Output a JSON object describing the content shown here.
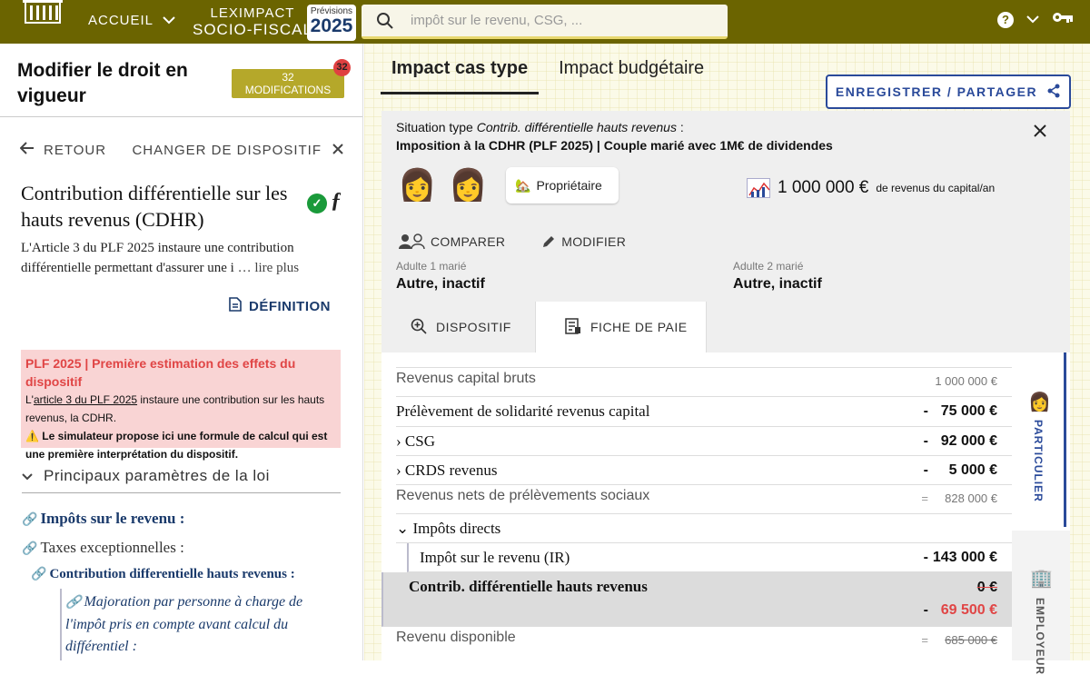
{
  "header": {
    "logo_text": "ASSEMBLÉE NATIONALE",
    "accueil": "ACCUEIL",
    "brand_line1": "LEXIMPACT",
    "brand_line2": "SOCIO-FISCAL",
    "previsions_label": "Prévisions",
    "previsions_year": "2025",
    "search_placeholder": "impôt sur le revenu, CSG, ..."
  },
  "left": {
    "title": "Modifier le droit en vigueur",
    "mod_count": "32",
    "mod_label": "MODIFICATIONS",
    "badge": "32",
    "back": "RETOUR",
    "change": "CHANGER DE DISPOSITIF",
    "provision_title": "Contribution différentielle sur les hauts revenus (CDHR)",
    "provision_desc": "L'Article 3 du PLF 2025 instaure une contribution différentielle permettant d'assurer une i",
    "read_more": "… lire plus",
    "definition": "DÉFINITION",
    "alert_title": "PLF 2025 | Première estimation des effets du dispositif",
    "alert_pre": "L'",
    "alert_link": "article 3 du PLF 2025",
    "alert_post": " instaure une contribution sur les hauts revenus, la CDHR.",
    "alert_warning": "⚠️ Le simulateur propose ici une formule de calcul qui est une première interprétation du dispositif.",
    "params_heading": "Principaux paramètres de la loi",
    "links": [
      "Impôts sur le revenu :",
      "Taxes exceptionnelles :",
      "Contribution differentielle hauts revenus :",
      "Majoration par personne à charge de l'impôt pris en compte avant calcul du différentiel :"
    ]
  },
  "right": {
    "tabs": [
      "Impact cas type",
      "Impact budgétaire"
    ],
    "save": "ENREGISTRER / PARTAGER",
    "situation_prefix": "Situation type ",
    "situation_italic": "Contrib. différentielle hauts revenus",
    "situation_suffix": " :",
    "situation_line2": "Imposition à la CDHR (PLF 2025) | Couple marié avec 1M€ de dividendes",
    "owner": "Propriétaire",
    "revenue_amount": "1 000 000 €",
    "revenue_label": "de revenus du capital/an",
    "compare": "COMPARER",
    "modify": "MODIFIER",
    "adult1_label": "Adulte 1 marié",
    "adult1_value": "Autre, inactif",
    "adult2_label": "Adulte 2 marié",
    "adult2_value": "Autre, inactif",
    "subtabs": [
      "DISPOSITIF",
      "FICHE DE PAIE"
    ],
    "side_tabs": [
      "PARTICULIER",
      "EMPLOYEUR"
    ],
    "rows": [
      {
        "label": "Revenus capital bruts",
        "op": "",
        "value": "1 000 000 €"
      },
      {
        "label": "Prélèvement de solidarité revenus capital",
        "op": "-",
        "value": "75 000 €"
      },
      {
        "label": "› CSG",
        "op": "-",
        "value": "92 000 €"
      },
      {
        "label": "› CRDS revenus",
        "op": "-",
        "value": "5 000 €"
      },
      {
        "label": "Revenus nets de prélèvements sociaux",
        "op": "=",
        "value": "828 000 €"
      },
      {
        "label": "⌄ Impôts directs",
        "op": "",
        "value": ""
      },
      {
        "label": "Impôt sur le revenu (IR)",
        "op": "-",
        "value": "143 000 €"
      },
      {
        "label": "Contrib. différentielle hauts revenus",
        "op": "",
        "value": "0 €",
        "op2": "-",
        "value2": "69 500 €"
      },
      {
        "label": "Revenu disponible",
        "op": "=",
        "value": "685 000 €"
      }
    ]
  },
  "colors": {
    "header": "#6b6400",
    "accent": "#2a4a9a",
    "alert_bg": "#f9d4d4",
    "alert_title": "#e04545",
    "negative": "#e04545"
  }
}
